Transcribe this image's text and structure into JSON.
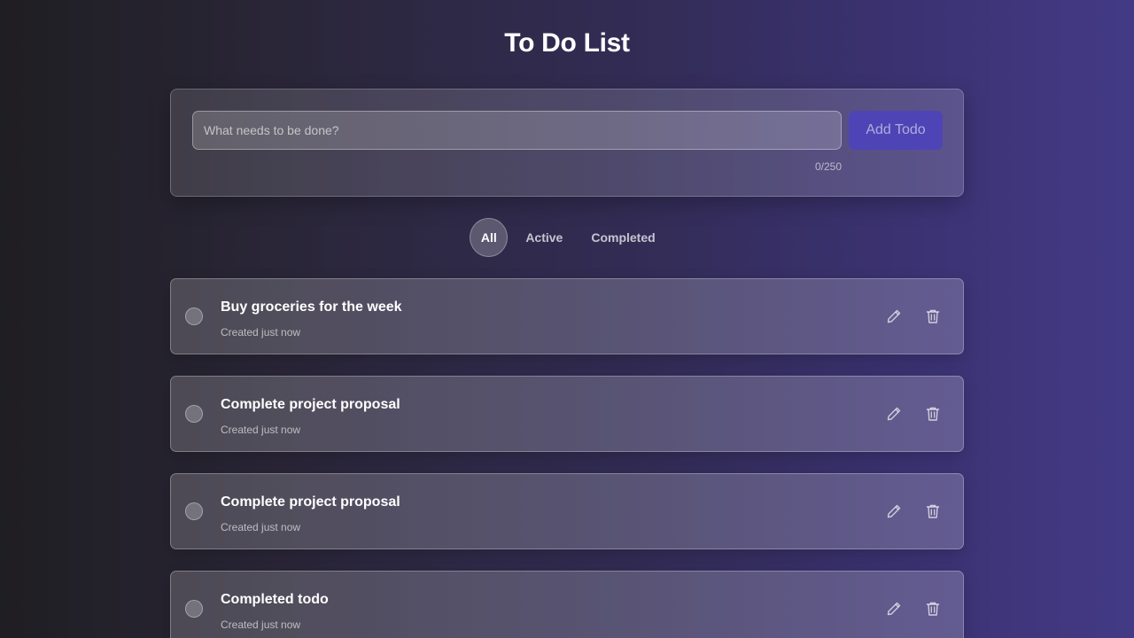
{
  "header": {
    "title": "To Do List"
  },
  "composer": {
    "placeholder": "What needs to be done?",
    "value": "",
    "add_label": "Add Todo",
    "char_count": "0/250"
  },
  "filters": {
    "all": "All",
    "active": "Active",
    "completed": "Completed",
    "selected": "All"
  },
  "todos": [
    {
      "text": "Buy groceries for the week",
      "meta": "Created just now",
      "completed": false
    },
    {
      "text": "Complete project proposal",
      "meta": "Created just now",
      "completed": false
    },
    {
      "text": "Complete project proposal",
      "meta": "Created just now",
      "completed": false
    },
    {
      "text": "Completed todo",
      "meta": "Created just now",
      "completed": false
    }
  ],
  "icons": {
    "edit": "pencil-icon",
    "delete": "trash-icon"
  },
  "colors": {
    "accent": "#4f44b5",
    "background_start": "#1f1e22",
    "background_end": "#433a86"
  }
}
